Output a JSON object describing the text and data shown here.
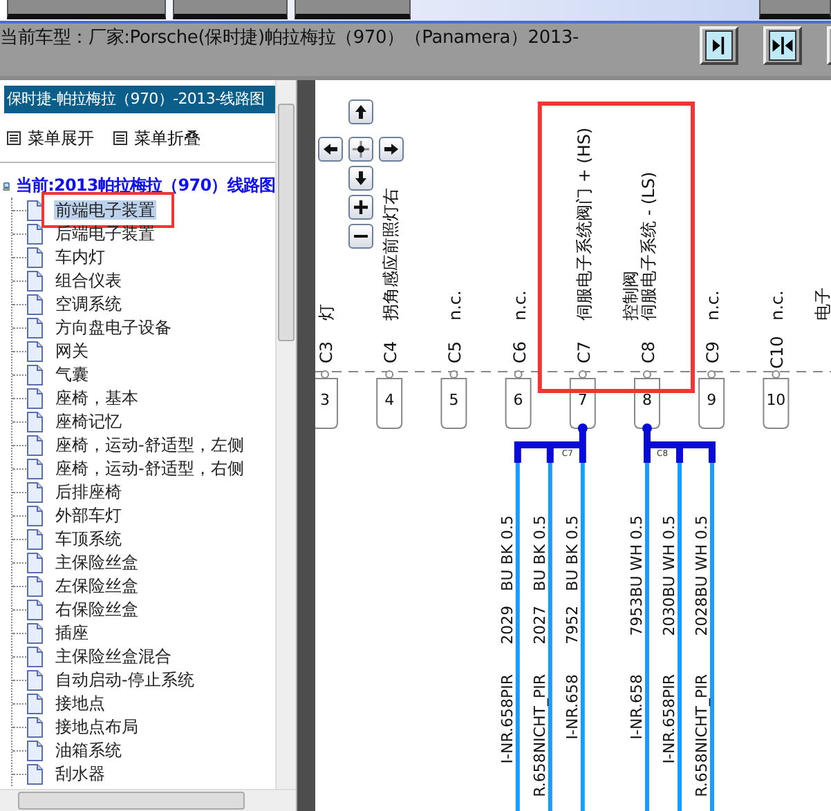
{
  "vehicle_bar": {
    "title": "当前车型：厂家:Porsche(保时捷)帕拉梅拉（970）（Panamera）2013-"
  },
  "sidebar": {
    "header": "保时捷-帕拉梅拉（970）-2013-线路图",
    "actions": [
      "菜单展开",
      "菜单折叠"
    ],
    "tree": {
      "label": "当前:2013帕拉梅拉（970）线路图",
      "children": [
        {
          "label": "前端电子装置",
          "selected": true,
          "highlighted": true
        },
        {
          "label": "后端电子装置",
          "selected": false,
          "highlighted": false
        },
        {
          "label": "车内灯",
          "selected": false,
          "highlighted": false
        },
        {
          "label": "组合仪表",
          "selected": false,
          "highlighted": false
        },
        {
          "label": "空调系统",
          "selected": false,
          "highlighted": false
        },
        {
          "label": "方向盘电子设备",
          "selected": false,
          "highlighted": false
        },
        {
          "label": "网关",
          "selected": false,
          "highlighted": false
        },
        {
          "label": "气囊",
          "selected": false,
          "highlighted": false
        },
        {
          "label": "座椅，基本",
          "selected": false,
          "highlighted": false
        },
        {
          "label": "座椅记忆",
          "selected": false,
          "highlighted": false
        },
        {
          "label": "座椅，运动-舒适型，左侧",
          "selected": false,
          "highlighted": false
        },
        {
          "label": "座椅，运动-舒适型，右侧",
          "selected": false,
          "highlighted": false
        },
        {
          "label": "后排座椅",
          "selected": false,
          "highlighted": false
        },
        {
          "label": "外部车灯",
          "selected": false,
          "highlighted": false
        },
        {
          "label": "车顶系统",
          "selected": false,
          "highlighted": false
        },
        {
          "label": "主保险丝盒",
          "selected": false,
          "highlighted": false
        },
        {
          "label": "左保险丝盒",
          "selected": false,
          "highlighted": false
        },
        {
          "label": "右保险丝盒",
          "selected": false,
          "highlighted": false
        },
        {
          "label": "插座",
          "selected": false,
          "highlighted": false
        },
        {
          "label": "主保险丝盒混合",
          "selected": false,
          "highlighted": false
        },
        {
          "label": "自动启动-停止系统",
          "selected": false,
          "highlighted": false
        },
        {
          "label": "接地点",
          "selected": false,
          "highlighted": false
        },
        {
          "label": "接地点布局",
          "selected": false,
          "highlighted": false
        },
        {
          "label": "油箱系统",
          "selected": false,
          "highlighted": false
        },
        {
          "label": "刮水器",
          "selected": false,
          "highlighted": false
        }
      ]
    }
  },
  "diagram": {
    "columns": [
      {
        "connector": "C3",
        "pin": "3",
        "labels": [
          "灯"
        ],
        "highlighted": false
      },
      {
        "connector": "C4",
        "pin": "4",
        "labels": [
          "拐角感应前照灯右"
        ],
        "highlighted": false
      },
      {
        "connector": "C5",
        "pin": "5",
        "labels": [
          "n.c."
        ],
        "highlighted": false
      },
      {
        "connector": "C6",
        "pin": "6",
        "labels": [
          "n.c."
        ],
        "highlighted": false
      },
      {
        "connector": "C7",
        "pin": "7",
        "labels": [
          "伺服电子系统阀门 + (HS)"
        ],
        "highlighted": true,
        "bus_label": "C7",
        "kind": "left-bus",
        "wires": [
          {
            "code": "2029   BU BK 0.5",
            "note": "I-NR.658PIR"
          },
          {
            "code": "2027   BU BK 0.5",
            "note": "R.658NICHT_PIR"
          },
          {
            "code": "7952   BU BK 0.5",
            "note": "I-NR.658"
          }
        ]
      },
      {
        "connector": "C8",
        "pin": "8",
        "labels": [
          "控制阀",
          "伺服电子系统 - (LS)"
        ],
        "highlighted": true,
        "bus_label": "C8",
        "kind": "right-bus",
        "wires": [
          {
            "code": "7953BU WH 0.5",
            "note": "I-NR.658"
          },
          {
            "code": "2030BU WH 0.5",
            "note": "I-NR.658PIR"
          },
          {
            "code": "2028BU WH 0.5",
            "note": "R.658NICHT_PIR"
          }
        ]
      },
      {
        "connector": "C9",
        "pin": "9",
        "labels": [
          "n.c."
        ],
        "highlighted": false
      },
      {
        "connector": "C10",
        "pin": "10",
        "labels": [
          "n.c."
        ],
        "highlighted": false
      },
      {
        "labels": [
          "电子"
        ],
        "highlighted": false
      }
    ]
  }
}
